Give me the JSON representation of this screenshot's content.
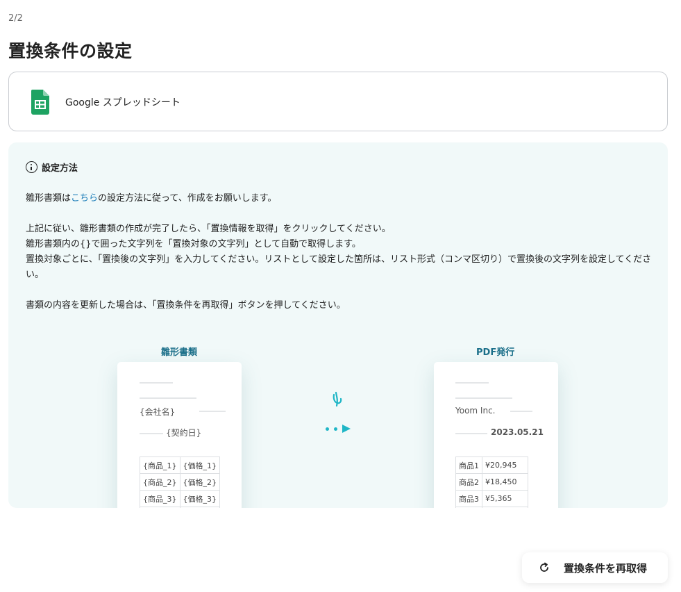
{
  "step": "2/2",
  "title": "置換条件の設定",
  "app": {
    "name": "Google スプレッドシート",
    "icon": "google-sheets-icon",
    "color": "#1ea362"
  },
  "info": {
    "heading": "設定方法",
    "para1_prefix": "雛形書類は",
    "para1_link": "こちら",
    "para1_suffix": "の設定方法に従って、作成をお願いします。",
    "para2_line1": "上記に従い、雛形書類の作成が完了したら、「置換情報を取得」をクリックしてください。",
    "para2_line2": "雛形書類内の{}で囲った文字列を「置換対象の文字列」として自動で取得します。",
    "para2_line3": "置換対象ごとに、「置換後の文字列」を入力してください。リストとして設定した箇所は、リスト形式（コンマ区切り）で置換後の文字列を設定してください。",
    "para3": "書類の内容を更新した場合は、「置換条件を再取得」ボタンを押してください。",
    "background_color": "#f1f9f9",
    "link_color": "#1a7cb8"
  },
  "illustration": {
    "template_label": "雛形書類",
    "template": {
      "company": "{会社名}",
      "date": "{契約日}",
      "rows": [
        [
          "{商品_1}",
          "{価格_1}"
        ],
        [
          "{商品_2}",
          "{価格_2}"
        ],
        [
          "{商品_3}",
          "{価格_3}"
        ]
      ]
    },
    "output_label": "PDF発行",
    "output": {
      "company": "Yoom Inc.",
      "date": "2023.05.21",
      "rows": [
        [
          "商品1",
          "¥20,945"
        ],
        [
          "商品2",
          "¥18,450"
        ],
        [
          "商品3",
          "¥5,365"
        ]
      ]
    },
    "accent_color": "#1fb6c6"
  },
  "refetch_button": {
    "label": "置換条件を再取得",
    "icon": "refresh-icon"
  }
}
